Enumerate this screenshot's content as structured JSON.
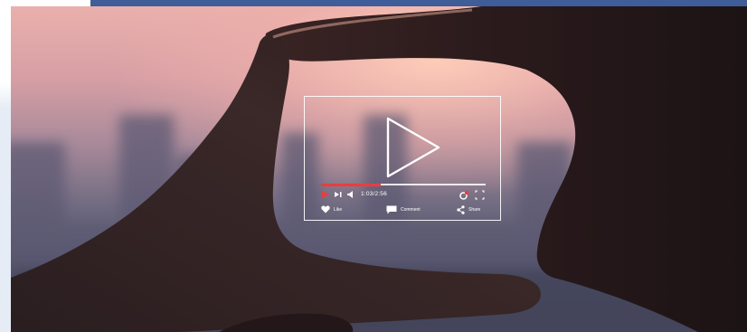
{
  "player": {
    "timecode": "1:03/2:56",
    "progress": 0.36,
    "actions": {
      "like": "Like",
      "comment": "Comment",
      "share": "Share"
    }
  },
  "colors": {
    "accent": "#ea3d3d",
    "top_band": "#3f5d98",
    "overlay": "#ffffff"
  },
  "icons": [
    "play-icon",
    "next-icon",
    "volume-icon",
    "settings-icon",
    "fullscreen-icon",
    "heart-icon",
    "comment-icon",
    "share-icon"
  ]
}
